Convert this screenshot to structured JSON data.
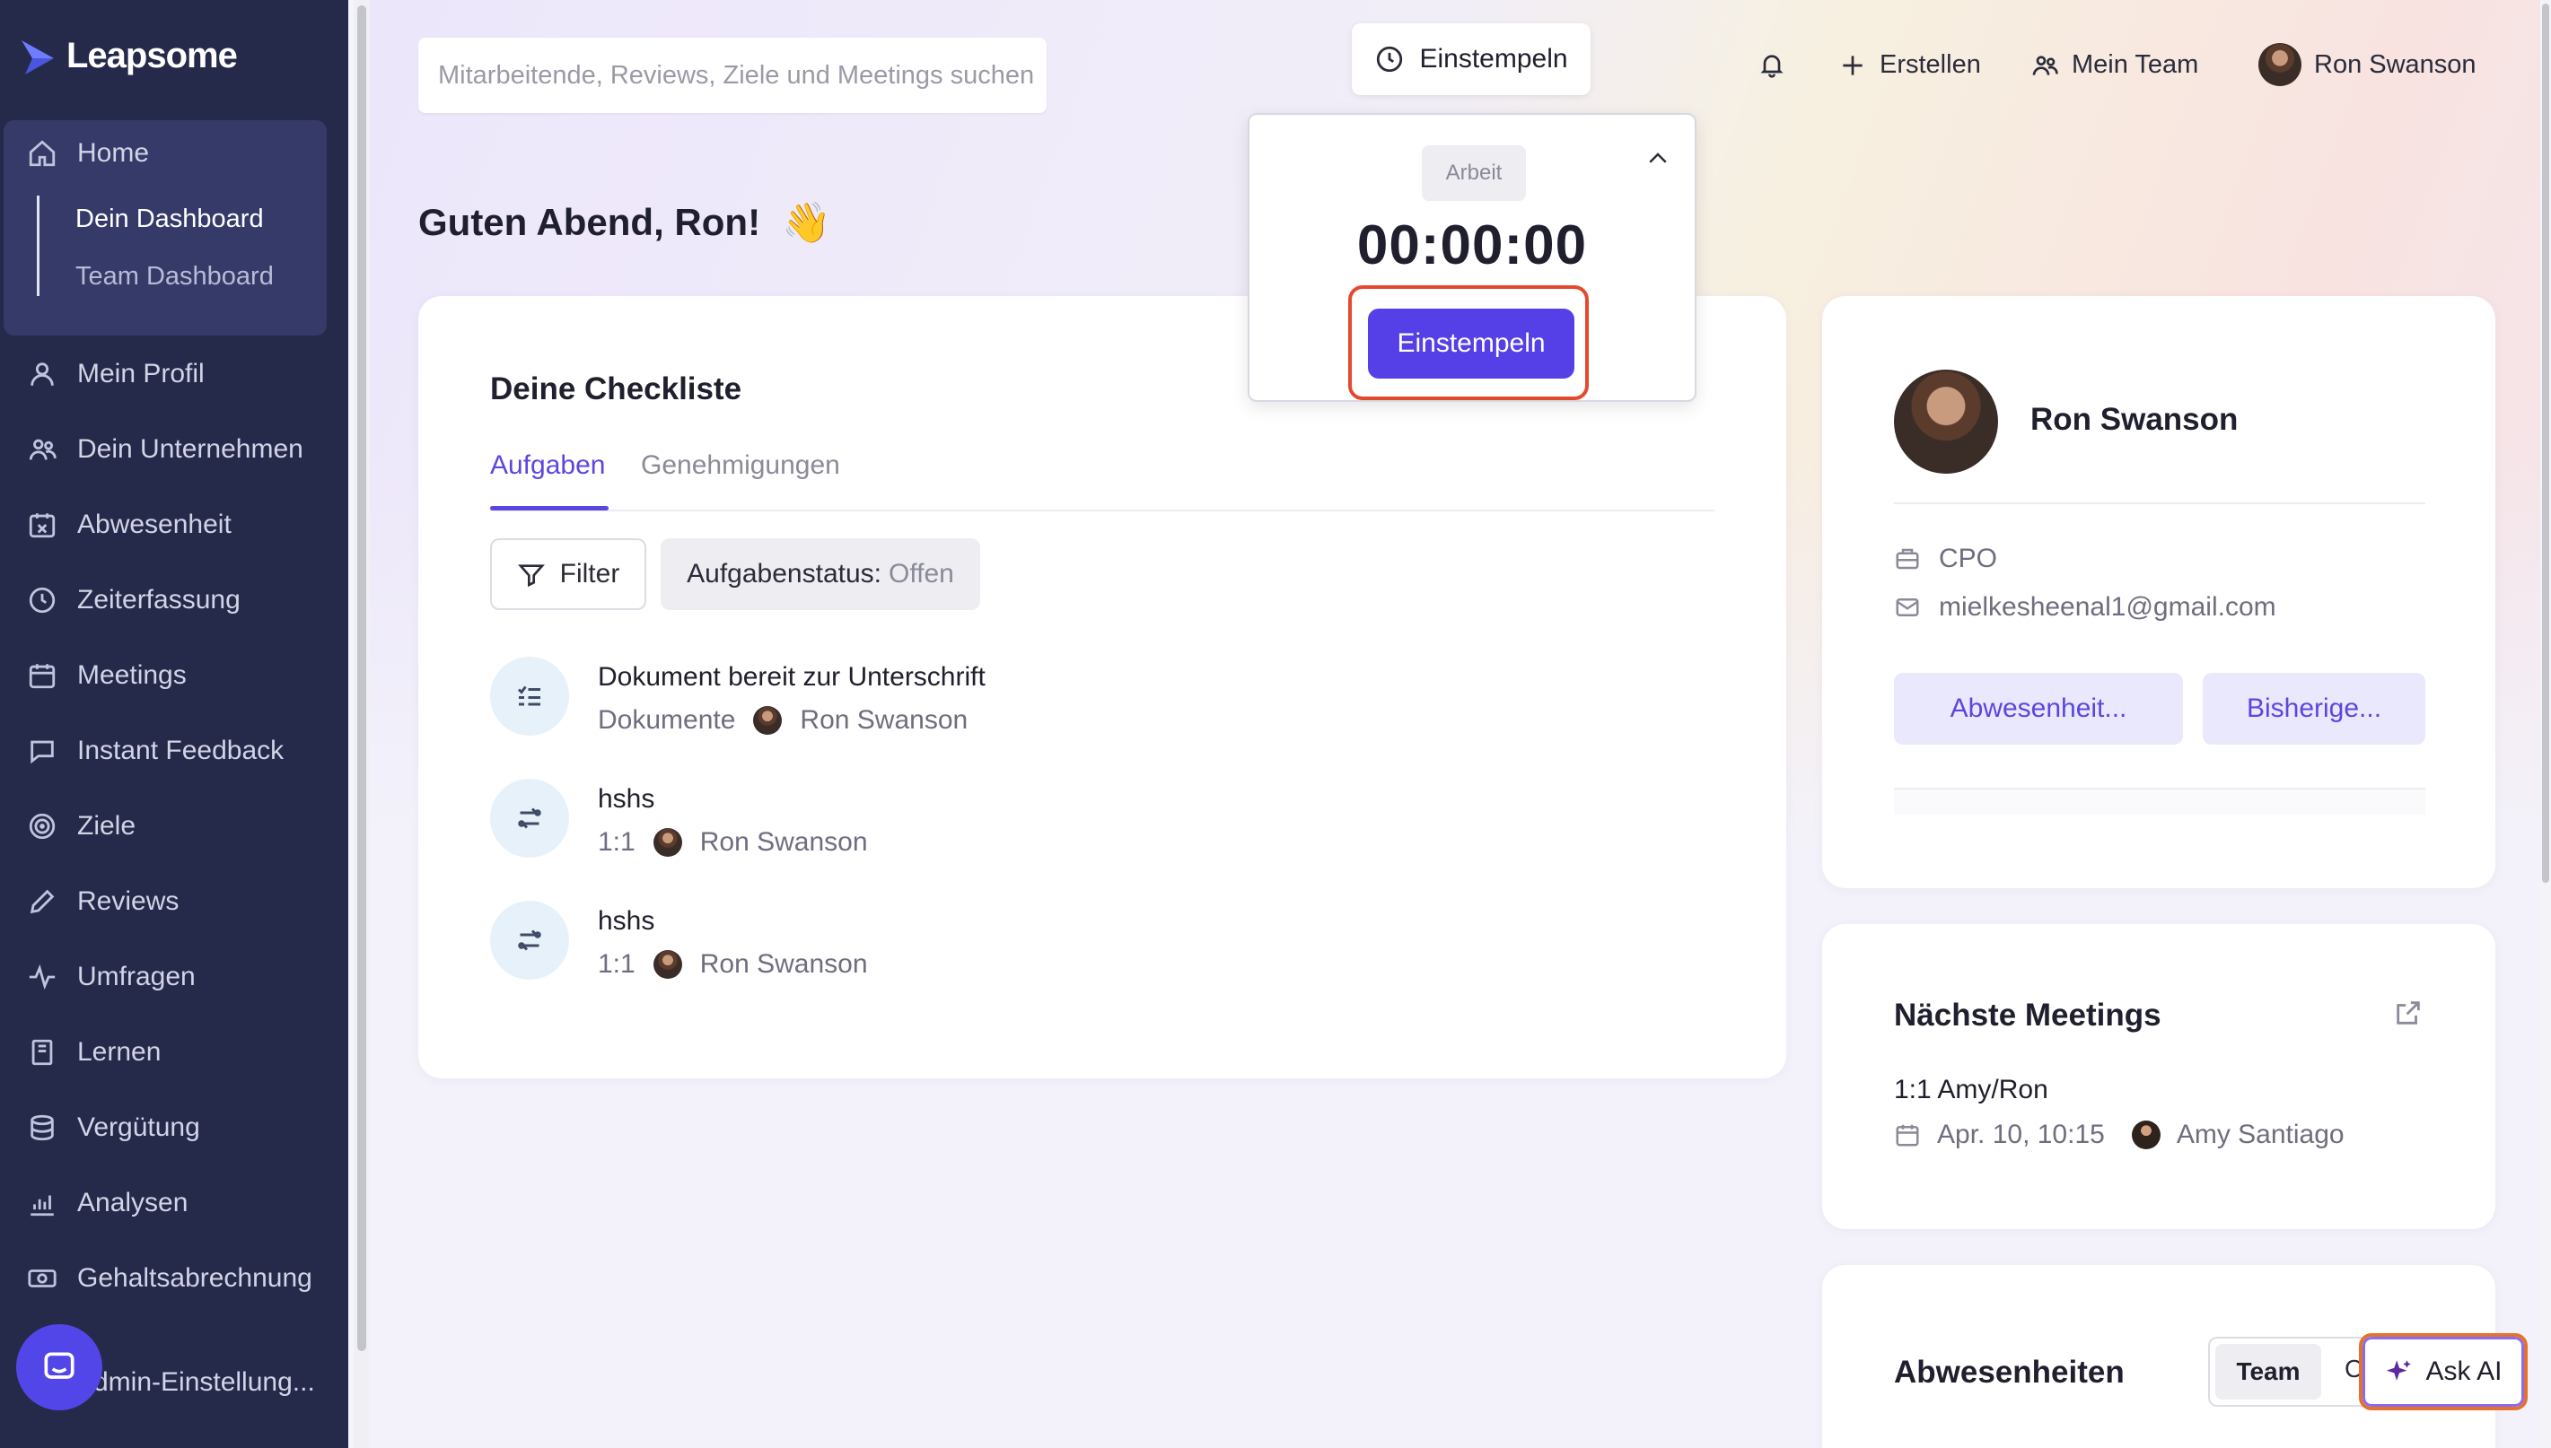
{
  "app": {
    "name": "Leapsome"
  },
  "sidebar": {
    "home": {
      "label": "Home",
      "sub": [
        "Dein Dashboard",
        "Team Dashboard"
      ]
    },
    "items": [
      {
        "label": "Mein Profil",
        "icon": "user-icon"
      },
      {
        "label": "Dein Unternehmen",
        "icon": "users-icon"
      },
      {
        "label": "Abwesenheit",
        "icon": "calendar-x-icon"
      },
      {
        "label": "Zeiterfassung",
        "icon": "clock-icon"
      },
      {
        "label": "Meetings",
        "icon": "calendar-icon"
      },
      {
        "label": "Instant Feedback",
        "icon": "chat-icon"
      },
      {
        "label": "Ziele",
        "icon": "target-icon"
      },
      {
        "label": "Reviews",
        "icon": "pencil-icon"
      },
      {
        "label": "Umfragen",
        "icon": "pulse-icon"
      },
      {
        "label": "Lernen",
        "icon": "book-icon"
      },
      {
        "label": "Vergütung",
        "icon": "coins-icon"
      },
      {
        "label": "Analysen",
        "icon": "chart-icon"
      },
      {
        "label": "Gehaltsabrechnung",
        "icon": "cash-icon"
      }
    ],
    "admin": "dmin-Einstellung..."
  },
  "header": {
    "search_placeholder": "Mitarbeitende, Reviews, Ziele und Meetings suchen",
    "stamp_label": "Einstempeln",
    "create_label": "Erstellen",
    "team_label": "Mein Team",
    "user_name": "Ron Swanson"
  },
  "greeting": {
    "text": "Guten Abend, Ron!",
    "emoji": "👋"
  },
  "popup": {
    "tag": "Arbeit",
    "timer": "00:00:00",
    "button": "Einstempeln"
  },
  "checklist": {
    "title": "Deine Checkliste",
    "tabs": [
      "Aufgaben",
      "Genehmigungen"
    ],
    "filter_label": "Filter",
    "status_label": "Aufgabenstatus:",
    "status_value": "Offen",
    "tasks": [
      {
        "title": "Dokument bereit zur Unterschrift",
        "category": "Dokumente",
        "person": "Ron Swanson"
      },
      {
        "title": "hshs",
        "category": "1:1",
        "person": "Ron Swanson"
      },
      {
        "title": "hshs",
        "category": "1:1",
        "person": "Ron Swanson"
      }
    ]
  },
  "profile": {
    "name": "Ron Swanson",
    "role": "CPO",
    "email": "mielkesheenal1@gmail.com",
    "btn_absence": "Abwesenheit...",
    "btn_history": "Bisherige..."
  },
  "meetings": {
    "title": "Nächste Meetings",
    "item_title": "1:1 Amy/Ron",
    "date": "Apr. 10, 10:15",
    "person": "Amy Santiago"
  },
  "absences": {
    "title": "Abwesenheiten",
    "seg_on": "Team",
    "seg_off": "C"
  },
  "ask_ai": "Ask AI",
  "colors": {
    "accent": "#5b47e0",
    "sidebar": "#25294a",
    "highlight": "#e4492e"
  }
}
